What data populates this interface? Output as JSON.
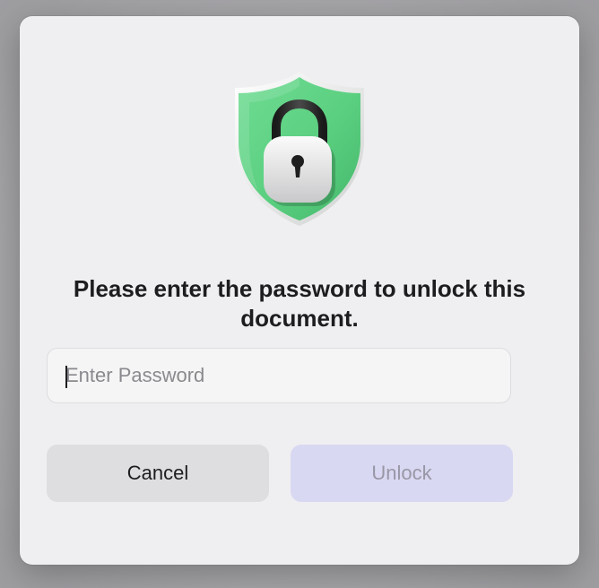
{
  "dialog": {
    "message": "Please enter the password to unlock this document.",
    "password_placeholder": "Enter Password",
    "password_value": "",
    "cancel_label": "Cancel",
    "unlock_label": "Unlock",
    "unlock_enabled": false
  },
  "icons": {
    "hero": "shield-lock-icon"
  },
  "colors": {
    "shield_green": "#5fd184",
    "unlock_disabled_bg": "#d9d8f2",
    "cancel_bg": "#dedde0",
    "dialog_bg": "#efeef1"
  }
}
